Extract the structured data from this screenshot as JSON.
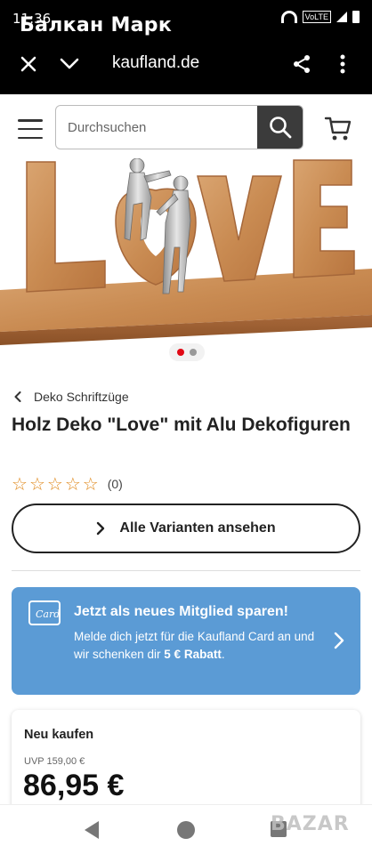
{
  "status_bar": {
    "time": "11:36",
    "app_title": "Балкан Марк",
    "volte": "VoLTE"
  },
  "browser": {
    "url": "kaufland.de"
  },
  "header": {
    "search_placeholder": "Durchsuchen"
  },
  "gallery": {
    "image_alt": "Holz Deko Love mit Alu Dekofiguren",
    "slides": 2,
    "active_slide": 1
  },
  "product": {
    "breadcrumb": "Deko Schriftzüge",
    "title": "Holz Deko \"Love\" mit Alu Dekofiguren",
    "rating_count": "(0)",
    "variants_button": "Alle Varianten ansehen"
  },
  "promo": {
    "headline": "Jetzt als neues Mitglied sparen!",
    "body_prefix": "Melde dich jetzt für die Kaufland Card an und wir schenken dir ",
    "body_bold": "5 € Rabatt",
    "body_suffix": ".",
    "card_label": "Card",
    "color": "#5b9bd5"
  },
  "buybox": {
    "label": "Neu kaufen",
    "uvp": "UVP 159,00 €",
    "price": "86,95 €"
  },
  "watermark": "BAZAR",
  "colors": {
    "topbar": "#000000",
    "accent_red": "#e10915",
    "star": "#e08a1e",
    "search_button": "#3b3b3b"
  }
}
